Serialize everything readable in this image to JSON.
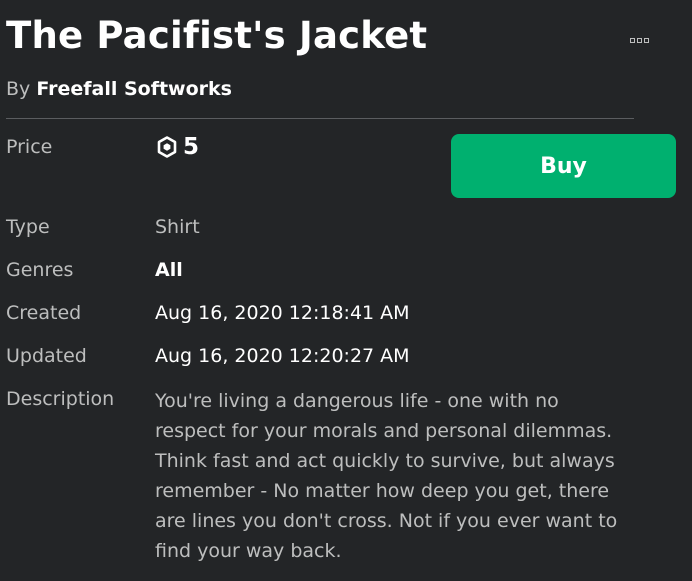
{
  "item": {
    "title": "The Pacifist's Jacket",
    "by_label": "By",
    "creator": "Freefall Softworks"
  },
  "price": {
    "label": "Price",
    "amount": "5",
    "currency_icon": "robux-icon"
  },
  "buy_label": "Buy",
  "more_icon": "more-options-icon",
  "details": {
    "type_label": "Type",
    "type_value": "Shirt",
    "genres_label": "Genres",
    "genres_value": "All",
    "created_label": "Created",
    "created_value": "Aug 16, 2020 12:18:41 AM",
    "updated_label": "Updated",
    "updated_value": "Aug 16, 2020 12:20:27 AM",
    "description_label": "Description",
    "description_lines": [
      "You're living a dangerous life - one with no",
      "respect for your morals and personal dilemmas.",
      "Think fast and act quickly to survive, but always",
      "remember - No matter how deep you get, there",
      "are lines you don't cross. Not if you ever want to",
      "find your way back."
    ]
  },
  "colors": {
    "background": "#232527",
    "text": "#ffffff",
    "muted_text": "#bdbebe",
    "buy_button": "#00b06f",
    "divider": "#5b5d60"
  }
}
